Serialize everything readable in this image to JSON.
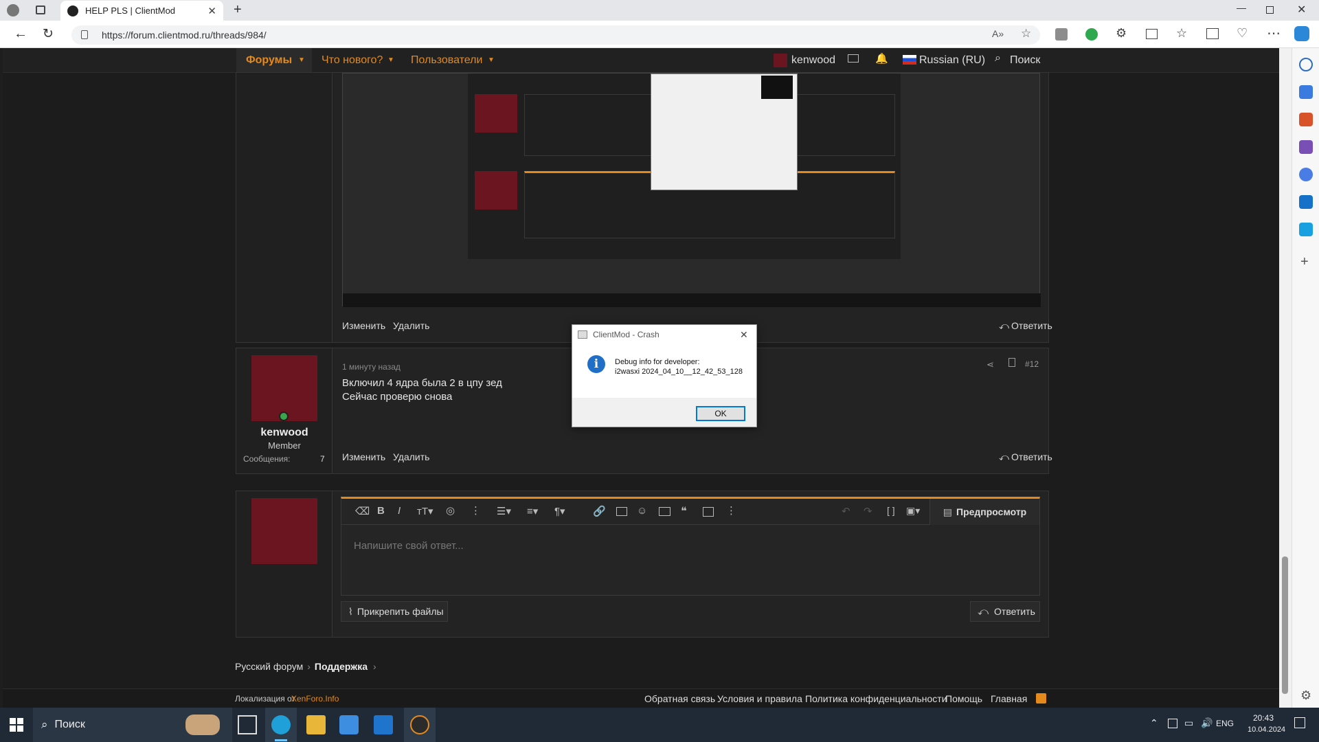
{
  "browser": {
    "tab_title": "HELP PLS | ClientMod",
    "url": "https://forum.clientmod.ru/threads/984/"
  },
  "nav": {
    "forums": "Форумы",
    "whats_new": "Что нового?",
    "users": "Пользователи",
    "username": "kenwood",
    "language": "Russian (RU)",
    "search": "Поиск"
  },
  "post_top": {
    "edit": "Изменить",
    "delete": "Удалить",
    "reply": "Ответить"
  },
  "post12": {
    "time": "1 минуту назад",
    "number": "#12",
    "line1": "Включил 4 ядра была 2 в цпу зед",
    "line2": "Сейчас проверю снова",
    "username": "kenwood",
    "role": "Member",
    "msgs_label": "Сообщения:",
    "msgs_count": "7",
    "edit": "Изменить",
    "delete": "Удалить",
    "reply": "Ответить"
  },
  "editor": {
    "placeholder": "Напишите свой ответ...",
    "preview": "Предпросмотр",
    "attach": "Прикрепить файлы",
    "reply": "Ответить"
  },
  "breadcrumb": {
    "forum": "Русский форум",
    "section": "Поддержка"
  },
  "footer": {
    "localization_prefix": "Локализация от",
    "localization_link": "XenForo.Info",
    "feedback": "Обратная связь",
    "terms": "Условия и правила",
    "privacy": "Политика конфиденциальности",
    "help": "Помощь",
    "home": "Главная"
  },
  "dialog": {
    "title": "ClientMod - Crash",
    "line1": "Debug info for developer:",
    "line2": "i2wasxi 2024_04_10__12_42_53_128",
    "ok": "OK"
  },
  "taskbar": {
    "search": "Поиск",
    "lang": "ENG",
    "time": "20:43",
    "date": "10.04.2024"
  },
  "colors": {
    "accent": "#e48a1c",
    "dialog_focus": "#0078d7"
  }
}
